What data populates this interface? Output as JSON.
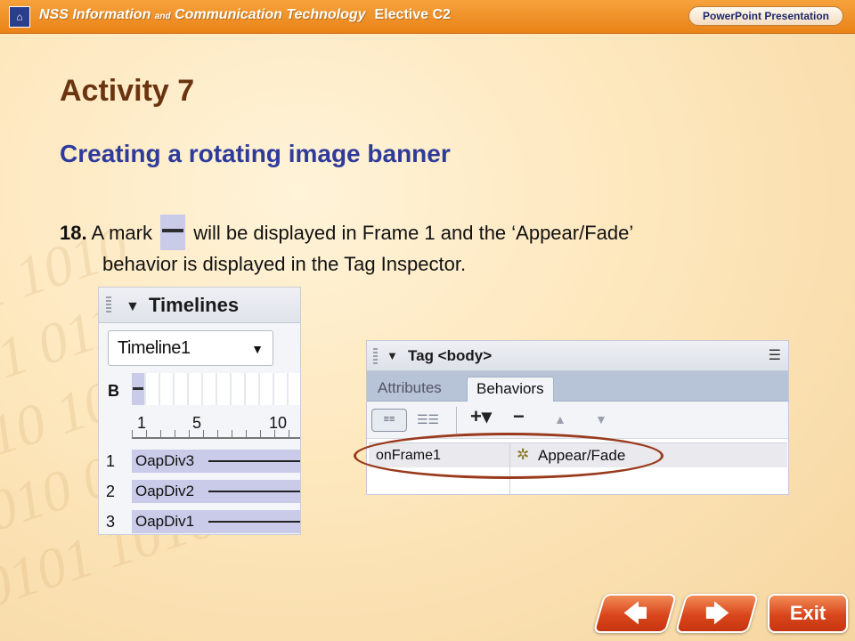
{
  "header": {
    "logo_text": "ᓮ",
    "title_part1": "NSS Information ",
    "title_and": "and",
    "title_part2": " Communication Technology",
    "elective": "Elective C2",
    "badge": "PowerPoint Presentation"
  },
  "slide": {
    "activity_title": "Activity 7",
    "subtitle": "Creating a rotating image banner",
    "step_number": "18.",
    "step_text_a": " A mark ",
    "step_text_b": " will be displayed in Frame 1 and the ‘Appear/Fade’",
    "step_text_c": "behavior is displayed in the Tag Inspector."
  },
  "timelines": {
    "panel_title": "Timelines",
    "selected_timeline": "Timeline1",
    "behavior_row_label": "B",
    "ruler": [
      "1",
      "5",
      "10"
    ],
    "rows": [
      {
        "num": "1",
        "name": "OapDiv3"
      },
      {
        "num": "2",
        "name": "OapDiv2"
      },
      {
        "num": "3",
        "name": "OapDiv1"
      }
    ]
  },
  "tag_inspector": {
    "panel_title": "Tag <body>",
    "tabs": [
      "Attributes",
      "Behaviors"
    ],
    "active_tab": "Behaviors",
    "behavior": {
      "event": "onFrame1",
      "action": "Appear/Fade"
    }
  },
  "navigation": {
    "prev": "🡄",
    "next": "🡆",
    "exit": "Exit"
  },
  "colors": {
    "header_orange": "#e98318",
    "activity_brown": "#6b3410",
    "subtitle_blue": "#2f3b9b",
    "highlight_ring": "#9a3a1c",
    "nav_red": "#d9461c"
  }
}
